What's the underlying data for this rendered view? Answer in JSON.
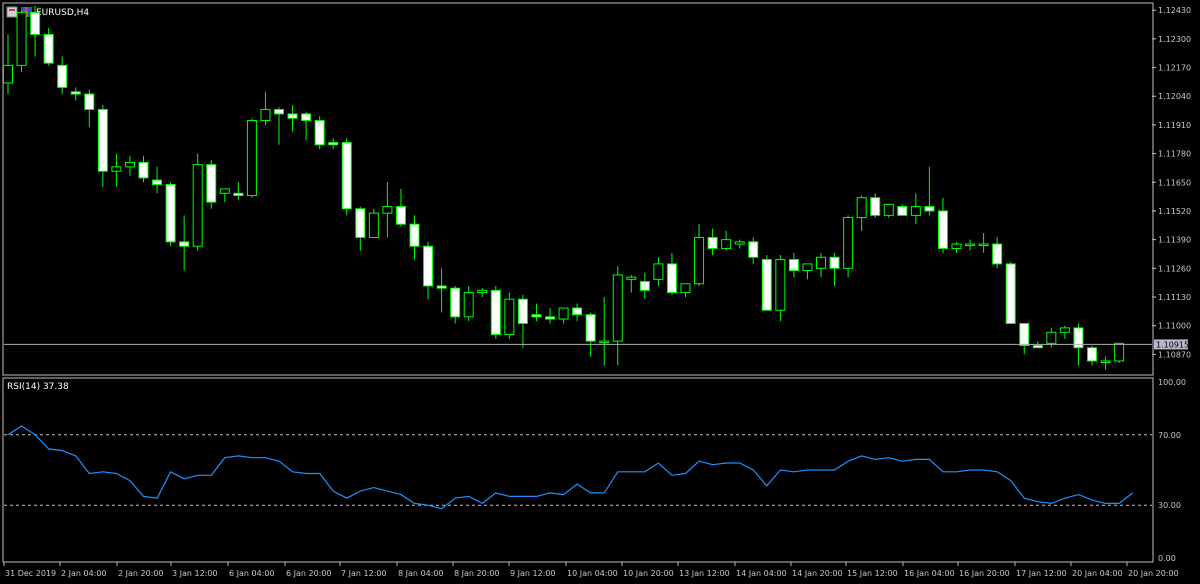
{
  "symbol_title": "EURUSD,H4",
  "indicator_title": "RSI(14) 37.38",
  "current_price_label": "1.10915",
  "colors": {
    "background": "#000000",
    "border": "#c0c0c0",
    "bull_fill": "#ffffff",
    "bear_fill": "#ffffff",
    "wick": "#00ff00",
    "candle_outline": "#00ff00",
    "rsi_line": "#1e90ff",
    "level_line": "#c0c0c0",
    "text": "#c8c8c8"
  },
  "icons": [
    "window-menu-icon",
    "symbol-flag-icon"
  ],
  "chart_data": [
    {
      "type": "candlestick",
      "title": "EURUSD,H4",
      "price_axis_labels": [
        "1.12430",
        "1.12300",
        "1.12170",
        "1.12040",
        "1.11910",
        "1.11780",
        "1.11650",
        "1.11520",
        "1.11390",
        "1.11260",
        "1.11130",
        "1.11000",
        "1.10870"
      ],
      "ylim": [
        1.1079,
        1.1244
      ],
      "current_price": 1.10915,
      "candles": [
        {
          "o": 1.121,
          "h": 1.1232,
          "l": 1.1205,
          "c": 1.1218
        },
        {
          "o": 1.1218,
          "h": 1.1243,
          "l": 1.1215,
          "c": 1.1242
        },
        {
          "o": 1.1242,
          "h": 1.1245,
          "l": 1.1222,
          "c": 1.1232
        },
        {
          "o": 1.1232,
          "h": 1.1235,
          "l": 1.1218,
          "c": 1.1219
        },
        {
          "o": 1.1218,
          "h": 1.1222,
          "l": 1.1205,
          "c": 1.1208
        },
        {
          "o": 1.1206,
          "h": 1.1208,
          "l": 1.1202,
          "c": 1.1205
        },
        {
          "o": 1.1205,
          "h": 1.1207,
          "l": 1.119,
          "c": 1.1198
        },
        {
          "o": 1.1198,
          "h": 1.12,
          "l": 1.1163,
          "c": 1.117
        },
        {
          "o": 1.117,
          "h": 1.1178,
          "l": 1.1163,
          "c": 1.1172
        },
        {
          "o": 1.1172,
          "h": 1.1177,
          "l": 1.1168,
          "c": 1.1174
        },
        {
          "o": 1.1174,
          "h": 1.1177,
          "l": 1.1165,
          "c": 1.1167
        },
        {
          "o": 1.1166,
          "h": 1.1172,
          "l": 1.116,
          "c": 1.1164
        },
        {
          "o": 1.1164,
          "h": 1.1165,
          "l": 1.1136,
          "c": 1.1138
        },
        {
          "o": 1.1138,
          "h": 1.115,
          "l": 1.1125,
          "c": 1.1136
        },
        {
          "o": 1.1136,
          "h": 1.1178,
          "l": 1.1134,
          "c": 1.1173
        },
        {
          "o": 1.1173,
          "h": 1.1175,
          "l": 1.1153,
          "c": 1.1156
        },
        {
          "o": 1.116,
          "h": 1.1162,
          "l": 1.1156,
          "c": 1.1162
        },
        {
          "o": 1.116,
          "h": 1.1165,
          "l": 1.1157,
          "c": 1.1159
        },
        {
          "o": 1.1159,
          "h": 1.1194,
          "l": 1.1158,
          "c": 1.1193
        },
        {
          "o": 1.1193,
          "h": 1.1206,
          "l": 1.1191,
          "c": 1.1198
        },
        {
          "o": 1.1198,
          "h": 1.1199,
          "l": 1.1182,
          "c": 1.1196
        },
        {
          "o": 1.1196,
          "h": 1.12,
          "l": 1.1188,
          "c": 1.1194
        },
        {
          "o": 1.1196,
          "h": 1.1197,
          "l": 1.1184,
          "c": 1.1193
        },
        {
          "o": 1.1193,
          "h": 1.1195,
          "l": 1.118,
          "c": 1.1182
        },
        {
          "o": 1.1183,
          "h": 1.1185,
          "l": 1.118,
          "c": 1.1182
        },
        {
          "o": 1.1183,
          "h": 1.1185,
          "l": 1.115,
          "c": 1.1153
        },
        {
          "o": 1.1153,
          "h": 1.1154,
          "l": 1.1134,
          "c": 1.114
        },
        {
          "o": 1.114,
          "h": 1.1153,
          "l": 1.114,
          "c": 1.1151
        },
        {
          "o": 1.1151,
          "h": 1.1165,
          "l": 1.114,
          "c": 1.1154
        },
        {
          "o": 1.1154,
          "h": 1.1162,
          "l": 1.1145,
          "c": 1.1146
        },
        {
          "o": 1.1146,
          "h": 1.115,
          "l": 1.113,
          "c": 1.1136
        },
        {
          "o": 1.1136,
          "h": 1.1138,
          "l": 1.1112,
          "c": 1.1118
        },
        {
          "o": 1.1118,
          "h": 1.1126,
          "l": 1.1106,
          "c": 1.1117
        },
        {
          "o": 1.1117,
          "h": 1.1118,
          "l": 1.1101,
          "c": 1.1104
        },
        {
          "o": 1.1104,
          "h": 1.1118,
          "l": 1.1102,
          "c": 1.1115
        },
        {
          "o": 1.1115,
          "h": 1.1117,
          "l": 1.1113,
          "c": 1.1116
        },
        {
          "o": 1.1116,
          "h": 1.1118,
          "l": 1.1094,
          "c": 1.1096
        },
        {
          "o": 1.1096,
          "h": 1.1115,
          "l": 1.1094,
          "c": 1.1112
        },
        {
          "o": 1.1112,
          "h": 1.1114,
          "l": 1.109,
          "c": 1.1101
        },
        {
          "o": 1.1105,
          "h": 1.111,
          "l": 1.1102,
          "c": 1.1104
        },
        {
          "o": 1.1104,
          "h": 1.1108,
          "l": 1.1101,
          "c": 1.1103
        },
        {
          "o": 1.1103,
          "h": 1.1108,
          "l": 1.1101,
          "c": 1.1108
        },
        {
          "o": 1.1108,
          "h": 1.111,
          "l": 1.1102,
          "c": 1.1105
        },
        {
          "o": 1.1105,
          "h": 1.1106,
          "l": 1.1086,
          "c": 1.1093
        },
        {
          "o": 1.1093,
          "h": 1.1113,
          "l": 1.1082,
          "c": 1.1093
        },
        {
          "o": 1.1093,
          "h": 1.1127,
          "l": 1.1082,
          "c": 1.1123
        },
        {
          "o": 1.1121,
          "h": 1.1123,
          "l": 1.1115,
          "c": 1.1122
        },
        {
          "o": 1.112,
          "h": 1.1124,
          "l": 1.1112,
          "c": 1.1116
        },
        {
          "o": 1.1121,
          "h": 1.1131,
          "l": 1.1118,
          "c": 1.1128
        },
        {
          "o": 1.1128,
          "h": 1.1133,
          "l": 1.1114,
          "c": 1.1115
        },
        {
          "o": 1.1115,
          "h": 1.1119,
          "l": 1.1113,
          "c": 1.1119
        },
        {
          "o": 1.1119,
          "h": 1.1146,
          "l": 1.1118,
          "c": 1.114
        },
        {
          "o": 1.114,
          "h": 1.1144,
          "l": 1.1132,
          "c": 1.1135
        },
        {
          "o": 1.1135,
          "h": 1.1143,
          "l": 1.1134,
          "c": 1.1139
        },
        {
          "o": 1.1137,
          "h": 1.1139,
          "l": 1.1135,
          "c": 1.1138
        },
        {
          "o": 1.1138,
          "h": 1.114,
          "l": 1.1128,
          "c": 1.1131
        },
        {
          "o": 1.113,
          "h": 1.1132,
          "l": 1.1107,
          "c": 1.1107
        },
        {
          "o": 1.1107,
          "h": 1.1132,
          "l": 1.1102,
          "c": 1.113
        },
        {
          "o": 1.113,
          "h": 1.1133,
          "l": 1.1122,
          "c": 1.1125
        },
        {
          "o": 1.1125,
          "h": 1.1128,
          "l": 1.1121,
          "c": 1.1128
        },
        {
          "o": 1.1126,
          "h": 1.1133,
          "l": 1.1122,
          "c": 1.1131
        },
        {
          "o": 1.1131,
          "h": 1.1133,
          "l": 1.1118,
          "c": 1.1126
        },
        {
          "o": 1.1126,
          "h": 1.115,
          "l": 1.1122,
          "c": 1.1149
        },
        {
          "o": 1.1149,
          "h": 1.1159,
          "l": 1.1143,
          "c": 1.1158
        },
        {
          "o": 1.1158,
          "h": 1.116,
          "l": 1.1149,
          "c": 1.115
        },
        {
          "o": 1.115,
          "h": 1.1155,
          "l": 1.1149,
          "c": 1.1155
        },
        {
          "o": 1.1154,
          "h": 1.1155,
          "l": 1.115,
          "c": 1.115
        },
        {
          "o": 1.115,
          "h": 1.116,
          "l": 1.1146,
          "c": 1.1154
        },
        {
          "o": 1.1154,
          "h": 1.1172,
          "l": 1.115,
          "c": 1.1152
        },
        {
          "o": 1.1152,
          "h": 1.1158,
          "l": 1.1133,
          "c": 1.1135
        },
        {
          "o": 1.1135,
          "h": 1.1138,
          "l": 1.1133,
          "c": 1.1137
        },
        {
          "o": 1.1137,
          "h": 1.1139,
          "l": 1.1134,
          "c": 1.1137
        },
        {
          "o": 1.1137,
          "h": 1.1142,
          "l": 1.1133,
          "c": 1.1137
        },
        {
          "o": 1.1137,
          "h": 1.114,
          "l": 1.1126,
          "c": 1.1128
        },
        {
          "o": 1.1128,
          "h": 1.1129,
          "l": 1.1101,
          "c": 1.1101
        },
        {
          "o": 1.1101,
          "h": 1.1101,
          "l": 1.1087,
          "c": 1.1091
        },
        {
          "o": 1.1091,
          "h": 1.1093,
          "l": 1.109,
          "c": 1.109
        },
        {
          "o": 1.1092,
          "h": 1.1099,
          "l": 1.109,
          "c": 1.1097
        },
        {
          "o": 1.1097,
          "h": 1.11,
          "l": 1.1094,
          "c": 1.1099
        },
        {
          "o": 1.1099,
          "h": 1.1101,
          "l": 1.1082,
          "c": 1.109
        },
        {
          "o": 1.109,
          "h": 1.1091,
          "l": 1.1082,
          "c": 1.1084
        },
        {
          "o": 1.1084,
          "h": 1.1086,
          "l": 1.108,
          "c": 1.1084
        },
        {
          "o": 1.1084,
          "h": 1.1092,
          "l": 1.1083,
          "c": 1.1092
        }
      ]
    },
    {
      "type": "line",
      "title": "RSI(14) 37.38",
      "ylim": [
        0,
        100
      ],
      "y_axis_labels": [
        "100.00",
        "70.00",
        "30.00",
        "0.00"
      ],
      "levels": [
        70,
        30
      ],
      "series": [
        {
          "values": [
            70,
            75,
            70,
            62,
            61,
            58,
            48,
            49,
            48,
            44,
            35,
            34,
            49,
            45,
            47,
            47,
            57,
            58,
            57,
            57,
            55,
            49,
            48,
            48,
            38,
            34,
            38,
            40,
            38,
            36,
            31,
            30,
            28,
            34,
            35,
            31,
            37,
            35,
            35,
            35,
            37,
            36,
            42,
            37,
            37,
            49,
            49,
            49,
            54,
            47,
            48,
            55,
            53,
            54,
            54,
            50,
            41,
            50,
            49,
            50,
            50,
            50,
            55,
            58,
            56,
            57,
            55,
            56,
            56,
            49,
            49,
            50,
            50,
            49,
            44,
            34,
            32,
            31,
            34,
            36,
            33,
            31,
            31,
            37
          ]
        }
      ]
    }
  ],
  "time_axis_labels": [
    "31 Dec 2019",
    "2 Jan 04:00",
    "2 Jan 20:00",
    "3 Jan 12:00",
    "6 Jan 04:00",
    "6 Jan 20:00",
    "7 Jan 12:00",
    "8 Jan 04:00",
    "8 Jan 20:00",
    "9 Jan 12:00",
    "10 Jan 04:00",
    "10 Jan 20:00",
    "13 Jan 12:00",
    "14 Jan 04:00",
    "14 Jan 20:00",
    "15 Jan 12:00",
    "16 Jan 04:00",
    "16 Jan 20:00",
    "17 Jan 12:00",
    "20 Jan 04:00",
    "20 Jan 20:00"
  ]
}
